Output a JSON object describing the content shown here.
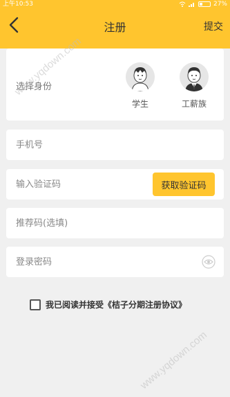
{
  "status_bar": {
    "time": "上午10:53",
    "battery": "27%",
    "battery_level": 0.27
  },
  "nav": {
    "title": "注册",
    "submit_label": "提交"
  },
  "identity": {
    "label": "选择身份",
    "roles": [
      {
        "label": "学生"
      },
      {
        "label": "工薪族"
      }
    ]
  },
  "form": {
    "phone_placeholder": "手机号",
    "code_placeholder": "输入验证码",
    "get_code_label": "获取验证码",
    "referral_placeholder": "推荐码(选填)",
    "password_placeholder": "登录密码"
  },
  "agreement": {
    "prefix": "我已阅读并接受",
    "link": "《桔子分期注册协议》",
    "checked": false
  },
  "watermark": "www.yqdown.com",
  "colors": {
    "accent": "#ffc52e",
    "background": "#f0f0f0"
  },
  "icons": [
    "back-arrow-icon",
    "student-avatar-icon",
    "worker-avatar-icon",
    "eye-icon",
    "wifi-icon",
    "signal-icon",
    "battery-icon"
  ]
}
